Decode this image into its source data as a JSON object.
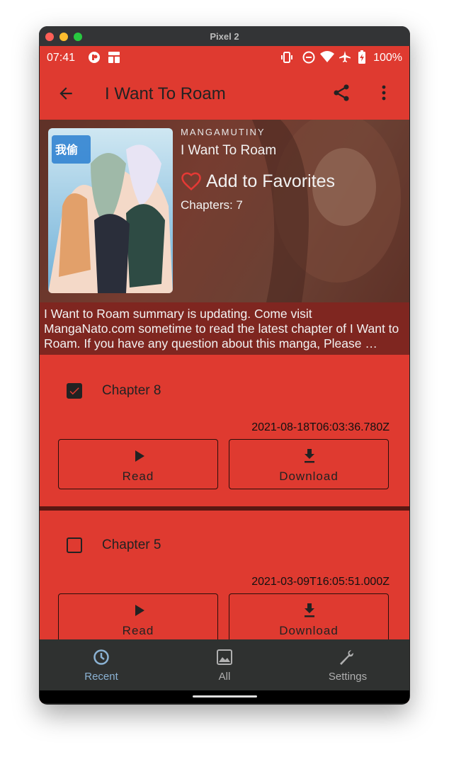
{
  "window": {
    "title": "Pixel 2"
  },
  "status_bar": {
    "time": "07:41",
    "battery": "100%"
  },
  "app_bar": {
    "title": "I Want To Roam",
    "icons": [
      "back-arrow-icon",
      "share-icon",
      "more-vert-icon"
    ]
  },
  "manga": {
    "source": "MANGAMUTINY",
    "title": "I Want To Roam",
    "favorite_label": "Add to Favorites",
    "chapters_text": "Chapters: 7",
    "summary": "I Want to Roam summary is updating. Come visit MangaNato.com sometime to read the latest chapter of I Want to Roam. If you have any question about this manga, Please …"
  },
  "chapters": [
    {
      "name": "Chapter 8",
      "date": "2021-08-18T06:03:36.780Z",
      "checked": true,
      "read_label": "Read",
      "download_label": "Download"
    },
    {
      "name": "Chapter 5",
      "date": "2021-03-09T16:05:51.000Z",
      "checked": false,
      "read_label": "Read",
      "download_label": "Download"
    }
  ],
  "bottom_nav": [
    {
      "label": "Recent",
      "icon": "clock-icon",
      "active": true
    },
    {
      "label": "All",
      "icon": "image-icon",
      "active": false
    },
    {
      "label": "Settings",
      "icon": "wrench-icon",
      "active": false
    }
  ],
  "colors": {
    "primary": "#df3a30",
    "summary_bg": "#7f2620",
    "nav_bg": "#2f3130",
    "nav_active": "#8bb2d3"
  }
}
